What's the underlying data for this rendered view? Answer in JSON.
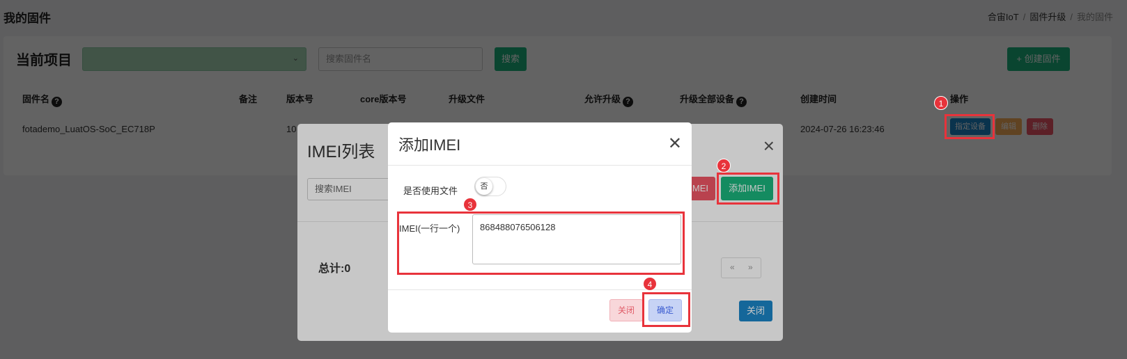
{
  "header": {
    "title": "我的固件",
    "breadcrumb": [
      "合宙IoT",
      "/",
      "固件升级",
      "/",
      "我的固件"
    ]
  },
  "toolbar": {
    "project_label": "当前项目",
    "project_value": "",
    "search_placeholder": "搜索固件名",
    "search_button": "搜索",
    "create_button": "+ 创建固件"
  },
  "table": {
    "headers": [
      "固件名",
      "备注",
      "版本号",
      "core版本号",
      "升级文件",
      "允许升级",
      "升级全部设备",
      "创建时间",
      "操作"
    ],
    "rows": [
      {
        "name": "fotademo_LuatOS-SoC_EC718P",
        "note": "",
        "version": "10",
        "created": "2024-07-26 16:23:46"
      }
    ],
    "actions": {
      "assign": "指定设备",
      "edit": "编辑",
      "delete": "删除"
    }
  },
  "imei_modal": {
    "title": "IMEI列表",
    "search_placeholder": "搜索IMEI",
    "delete_button": "IMEI",
    "add_button": "添加IMEI",
    "total": "总计:0",
    "pager_prev": "«",
    "pager_next": "»",
    "close_button": "关闭"
  },
  "add_modal": {
    "title": "添加IMEI",
    "use_file_label": "是否使用文件",
    "toggle_text": "否",
    "imei_label": "IMEI(一行一个)",
    "imei_value": "868488076506128",
    "close_button": "关闭",
    "confirm_button": "确定"
  },
  "annotations": [
    "1",
    "2",
    "3",
    "4"
  ],
  "colors": {
    "primary": "#1ab37c",
    "danger": "#ed5565",
    "highlight": "#e8333b",
    "info": "#1c84c6"
  }
}
